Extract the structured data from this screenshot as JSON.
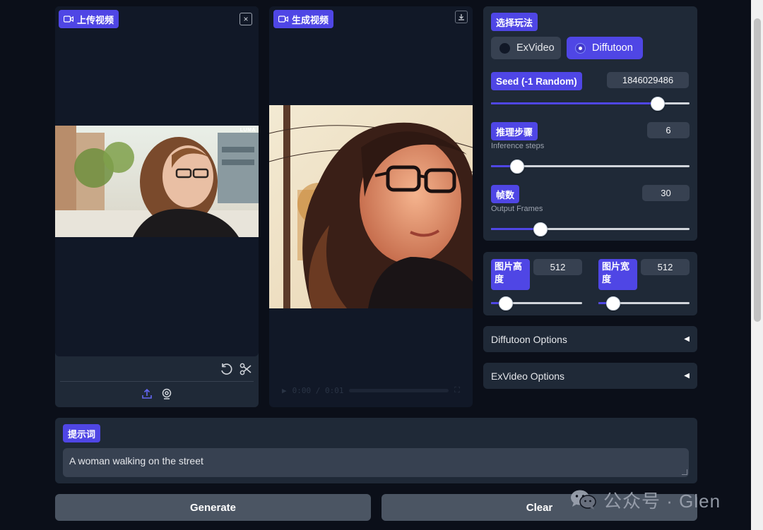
{
  "upload": {
    "label": "上传视频",
    "close_label": "×",
    "watermark_text": "LUMA"
  },
  "output": {
    "label": "生成视频",
    "player_time": "0:00 / 0:01"
  },
  "mode": {
    "label": "选择玩法",
    "options": [
      "ExVideo",
      "Diffutoon"
    ],
    "selected": "Diffutoon"
  },
  "seed": {
    "label": "Seed (-1 Random)",
    "value": "1846029486",
    "slider_fraction": 0.84
  },
  "steps": {
    "label": "推理步骤",
    "sublabel": "Inference steps",
    "value": "6",
    "slider_fraction": 0.13
  },
  "frames": {
    "label": "帧数",
    "sublabel": "Output Frames",
    "value": "30",
    "slider_fraction": 0.25
  },
  "height": {
    "label": "图片高度",
    "value": "512",
    "slider_fraction": 0.16
  },
  "width": {
    "label": "图片宽度",
    "value": "512",
    "slider_fraction": 0.16
  },
  "accordions": {
    "diffutoon": "Diffutoon Options",
    "exvideo": "ExVideo Options",
    "arrow": "◀"
  },
  "prompt": {
    "label": "提示词",
    "value": "A woman walking on the street"
  },
  "buttons": {
    "generate": "Generate",
    "clear": "Clear"
  },
  "watermark": {
    "text": "公众号 · Glen"
  },
  "colors": {
    "accent": "#4f46e5",
    "background": "#0b0f19",
    "panel": "#1f2937",
    "input": "#374151"
  }
}
